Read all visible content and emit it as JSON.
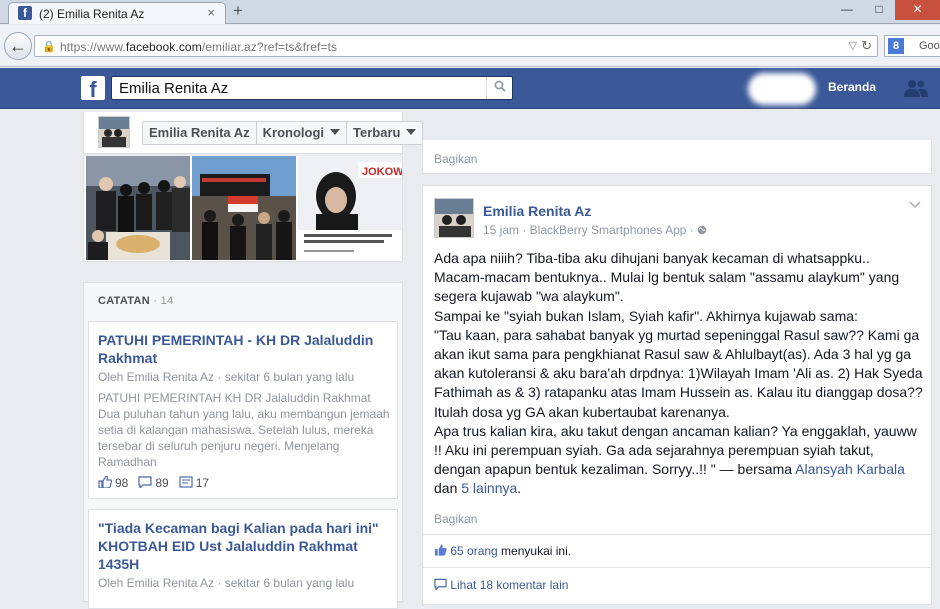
{
  "browser": {
    "tab_title": "(2) Emilia Renita Az",
    "tab_close": "×",
    "new_tab": "+",
    "url_prefix": "https://www.",
    "url_domain": "facebook.com",
    "url_path": "/emiliar.az?ref=ts&fref=ts",
    "search_engine_letter": "8",
    "search_text": "Goo"
  },
  "fb": {
    "logo": "f",
    "search_query": "Emilia Renita Az",
    "home_link": "Beranda"
  },
  "profile_header": {
    "name_button": "Emilia Renita Az",
    "timeline_button": "Kronologi",
    "sort_button": "Terbaru"
  },
  "notes": {
    "heading": "CATATAN",
    "count": "· 14",
    "items": [
      {
        "title": "PATUHI PEMERINTAH - KH DR Jalaluddin Rakhmat",
        "meta": "Oleh Emilia Renita Az · sekitar 6 bulan yang lalu",
        "excerpt": "PATUHI PEMERINTAH KH DR Jalaluddin Rakhmat Dua puluhan tahun yang lalu, aku membangun jemaah setia di kalangan mahasiswa. Setelah lulus, mereka tersebar di seluruh penjuru negeri. Menjelang Ramadhan",
        "likes": "98",
        "comments": "89",
        "shares": "17"
      },
      {
        "title": "\"Tiada Kecaman bagi Kalian pada hari ini\" KHOTBAH EID Ust Jalaluddin Rakhmat 1435H",
        "meta": "Oleh Emilia Renita Az · sekitar 6 bulan yang lalu"
      }
    ]
  },
  "prev_post": {
    "share": "Bagikan"
  },
  "post": {
    "author": "Emilia Renita Az",
    "meta": "15 jam · BlackBerry Smartphones App · ",
    "body": "Ada apa niiih? Tiba-tiba aku dihujani banyak kecaman di whatsappku..\nMacam-macam bentuknya.. Mulai lg bentuk salam \"assamu alaykum\" yang segera kujawab \"wa alaykum\".\nSampai ke \"syiah bukan Islam, Syiah kafir\". Akhirnya kujawab sama:\n\"Tau kaan, para sahabat banyak yg murtad sepeninggal Rasul saw?? Kami ga akan ikut sama para pengkhianat Rasul saw & Ahlulbayt(as). Ada 3 hal yg ga akan kutoleransi & aku bara'ah drpdnya: 1)Wilayah Imam 'Ali as. 2) Hak Syeda Fathimah as & 3) ratapanku atas Imam Hussein as. Kalau itu dianggap dosa?? Itulah dosa yg GA akan kubertaubat karenanya.\nApa trus kalian kira, aku takut dengan ancaman kalian? Ya enggaklah, yauww !! Aku ini perempuan syiah. Ga ada sejarahnya perempuan syiah takut, dengan apapun bentuk kezaliman. Sorryy..!! \" — bersama ",
    "tag1": "Alansyah Karbala",
    "tag_join": " dan ",
    "tag2": "5 lainnya",
    "tag_end": ".",
    "share": "Bagikan",
    "likes_count": "65 orang",
    "likes_suffix": " menyukai ini.",
    "view_comments": "Lihat 18 komentar lain"
  },
  "colors": {
    "fb_blue": "#3b5998",
    "link": "#3b5998",
    "muted": "#9197a3"
  }
}
